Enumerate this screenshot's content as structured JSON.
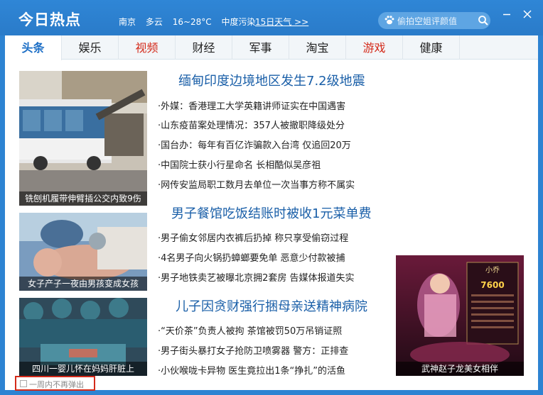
{
  "window": {
    "app_title": "今日热点",
    "weather": {
      "city": "南京",
      "condition": "多云",
      "temp": "16~28°C",
      "pollution": "中度污染"
    },
    "forecast_link": "15日天气 >>",
    "search_placeholder": "偷拍空姐评颜值"
  },
  "tabs": [
    {
      "label": "头条",
      "active": true
    },
    {
      "label": "娱乐"
    },
    {
      "label": "视频",
      "red": true
    },
    {
      "label": "财经"
    },
    {
      "label": "军事"
    },
    {
      "label": "淘宝"
    },
    {
      "label": "游戏",
      "red": true
    },
    {
      "label": "健康"
    }
  ],
  "sections": [
    {
      "image_caption": "铣刨机履带伸臂插公交内致9伤",
      "headline": "缅甸印度边境地区发生7.2级地震",
      "items": [
        "·外媒：香港理工大学英籍讲师证实在中国遇害",
        "·山东疫苗案处理情况：357人被撤职降级处分",
        "·国台办：每年有百亿诈骗款入台湾 仅追回20万",
        "·中国院士获小行星命名 长相酷似吴彦祖",
        "·网传安监局职工数月去单位一次当事方称不属实"
      ]
    },
    {
      "image_caption": "女子产子一夜由男孩变成女孩",
      "headline": "男子餐馆吃饭结账时被收1元菜单费",
      "items": [
        "·男子偷女邻居内衣裤后扔掉 称只享受偷窃过程",
        "·4名男子向火锅扔蟑螂要免单 恶意少付款被捕",
        "·男子地铁卖艺被曝北京拥2套房 告媒体报道失实"
      ]
    },
    {
      "image_caption": "四川一婴儿怀在妈妈肝脏上",
      "headline": "儿子因贪财强行捆母亲送精神病院",
      "items": [
        "·“天价茶”负责人被拘 茶馆被罚50万吊销证照",
        "·男子街头暴打女子抢防卫喷雾器 警方：正排查",
        "·小伙喉咙卡异物 医生竟拉出1条“挣扎”的活鱼"
      ]
    }
  ],
  "ad": {
    "caption": "武神赵子龙美女相伴",
    "game_name": "小乔",
    "score": "7600"
  },
  "hide_week_label": "一周内不再弹出",
  "colors": {
    "titlebar": "#2d83d2",
    "accent": "#1d6fc6",
    "red_tab": "#d42a1a",
    "headline": "#1a5fa8"
  }
}
